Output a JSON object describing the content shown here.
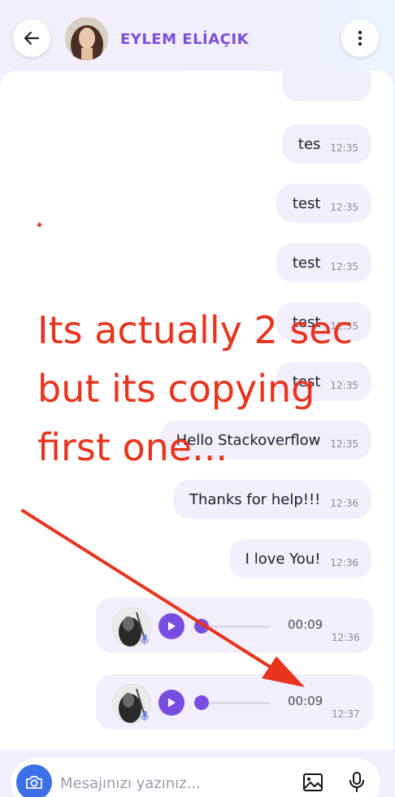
{
  "header": {
    "contact_name": "EYLEM  ELİAÇIK"
  },
  "messages": [
    {
      "text": "tes",
      "time": "12:35"
    },
    {
      "text": "test",
      "time": "12:35"
    },
    {
      "text": "test",
      "time": "12:35"
    },
    {
      "text": "test",
      "time": "12:35"
    },
    {
      "text": "test",
      "time": "12:35"
    },
    {
      "text": "Hello Stackoverflow",
      "time": "12:35"
    },
    {
      "text": "Thanks for help!!!",
      "time": "12:36"
    },
    {
      "text": "I love You!",
      "time": "12:36"
    }
  ],
  "voice_messages": [
    {
      "duration": "00:09",
      "time": "12:36"
    },
    {
      "duration": "00:09",
      "time": "12:37"
    }
  ],
  "annotation": {
    "text": "Its actually 2 sec\nbut its copying\nfirst one..."
  },
  "input": {
    "placeholder": "Mesajınızı yazınız..."
  },
  "colors": {
    "accent": "#7a4de2",
    "camera": "#3d6fe6",
    "annotation": "#e8341c",
    "bubble": "#f2eefb"
  },
  "icons": [
    "back-arrow-icon",
    "more-vertical-icon",
    "play-icon",
    "mic-icon",
    "camera-icon",
    "image-icon"
  ]
}
